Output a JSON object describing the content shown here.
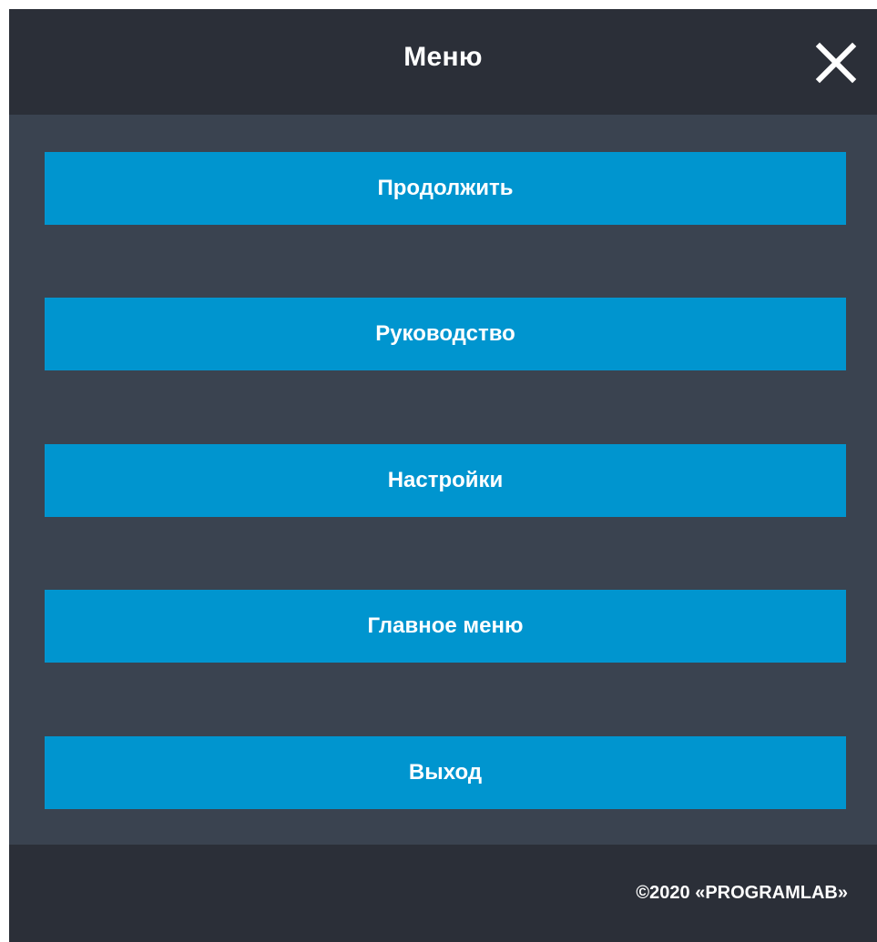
{
  "header": {
    "title": "Меню",
    "close_icon": "close-icon"
  },
  "menu": {
    "items": [
      {
        "label": "Продолжить"
      },
      {
        "label": "Руководство"
      },
      {
        "label": "Настройки"
      },
      {
        "label": "Главное меню"
      },
      {
        "label": "Выход"
      }
    ]
  },
  "footer": {
    "copyright": "©2020 «PROGRAMLAB»"
  },
  "colors": {
    "background_dark": "#2b2f38",
    "panel": "#3a4350",
    "accent": "#0095cf",
    "text": "#ffffff"
  }
}
